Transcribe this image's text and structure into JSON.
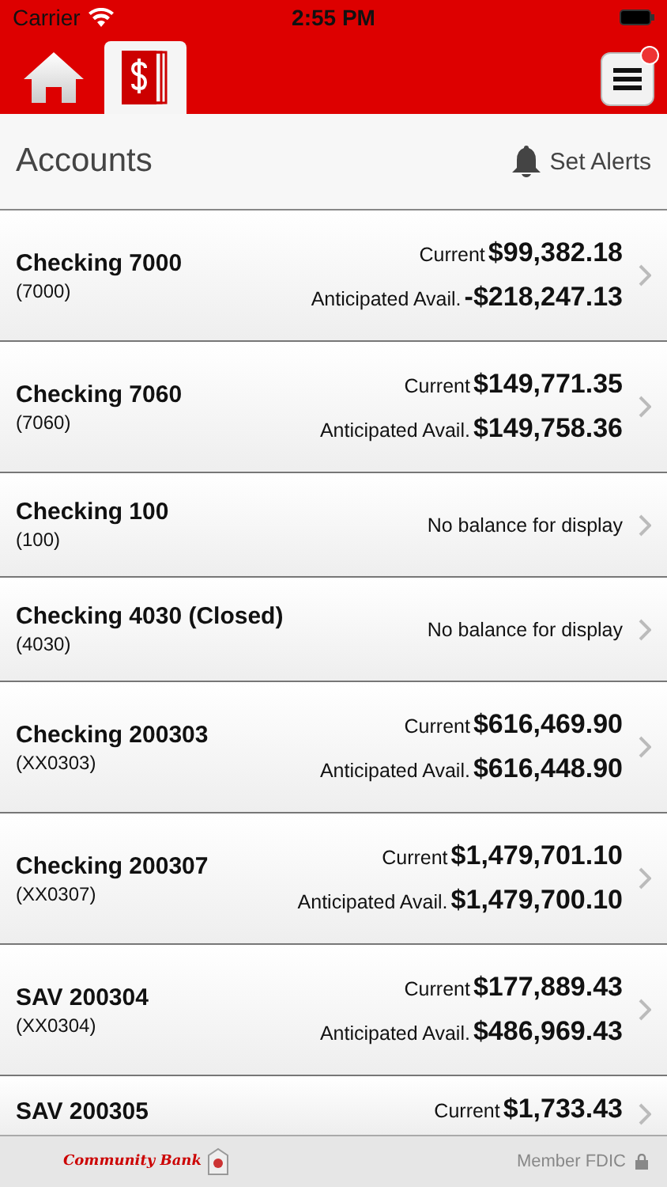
{
  "status_bar": {
    "carrier": "Carrier",
    "time": "2:55 PM"
  },
  "tabs": [
    {
      "kind": "home",
      "selected": false
    },
    {
      "kind": "accounts",
      "selected": true
    }
  ],
  "menu": {
    "notification": true
  },
  "header": {
    "title": "Accounts",
    "alerts": "Set Alerts"
  },
  "accounts": [
    {
      "name": "Checking 7000",
      "number": "(7000)",
      "current_label": "Current",
      "current": "$99,382.18",
      "anticipated_label": "Anticipated Avail.",
      "anticipated": "-$218,247.13"
    },
    {
      "name": "Checking 7060",
      "number": "(7060)",
      "current_label": "Current",
      "current": "$149,771.35",
      "anticipated_label": "Anticipated Avail.",
      "anticipated": "$149,758.36"
    },
    {
      "name": "Checking 100",
      "number": "(100)",
      "note": "No balance for display"
    },
    {
      "name": "Checking 4030 (Closed)",
      "number": "(4030)",
      "note": "No balance for display"
    },
    {
      "name": "Checking 200303",
      "number": "(XX0303)",
      "current_label": "Current",
      "current": "$616,469.90",
      "anticipated_label": "Anticipated Avail.",
      "anticipated": "$616,448.90"
    },
    {
      "name": "Checking 200307",
      "number": "(XX0307)",
      "current_label": "Current",
      "current": "$1,479,701.10",
      "anticipated_label": "Anticipated Avail.",
      "anticipated": "$1,479,700.10"
    },
    {
      "name": "SAV 200304",
      "number": "(XX0304)",
      "current_label": "Current",
      "current": "$177,889.43",
      "anticipated_label": "Anticipated Avail.",
      "anticipated": "$486,969.43"
    },
    {
      "name": "SAV 200305",
      "current_label": "Current",
      "current": "$1,733.43"
    }
  ],
  "footer": {
    "logo": "Community Bank",
    "member": "Member FDIC"
  }
}
